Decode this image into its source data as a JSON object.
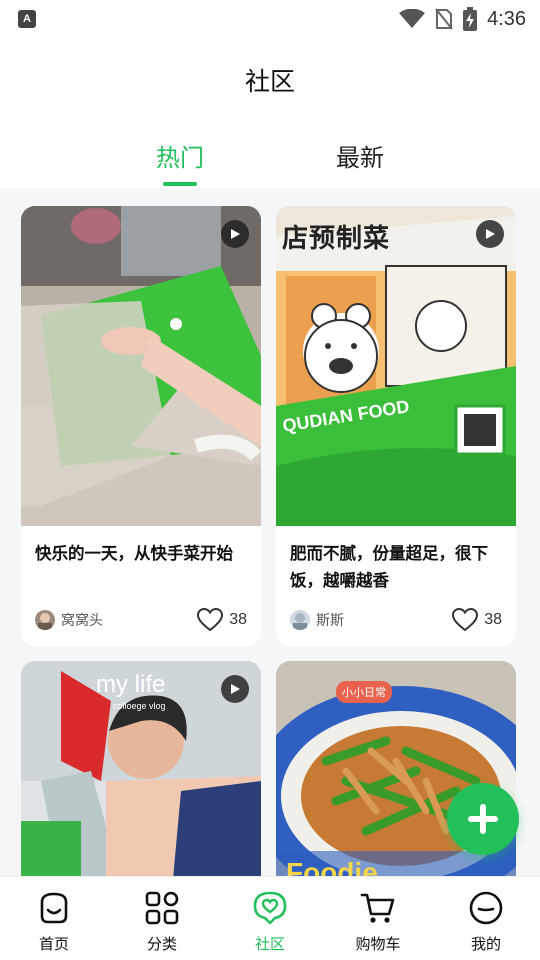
{
  "status_bar": {
    "notification_icon": "a-badge-icon",
    "badge_letter": "A",
    "time": "4:36",
    "icons": [
      "wifi-icon",
      "no-sim-icon",
      "battery-charging-icon"
    ]
  },
  "header": {
    "title": "社区",
    "tabs": [
      {
        "label": "热门",
        "active": true
      },
      {
        "label": "最新",
        "active": false
      }
    ]
  },
  "feed": {
    "cards": [
      {
        "title": "快乐的一天，从快手菜开始",
        "author": "窝窝头",
        "likes": "38",
        "is_video": true,
        "image": "hands-holding-green-food-package"
      },
      {
        "title": "肥而不腻，份量超足，很下饭，越嚼越香",
        "author": "斯斯",
        "likes": "38",
        "is_video": true,
        "image": "green-prepared-meal-package-with-cartoon-bear",
        "overlay_texts": [
          "店预制菜",
          "QUDIAN FOOD"
        ]
      },
      {
        "title": "",
        "author": "",
        "likes": "",
        "is_video": true,
        "image": "child-holding-bag-my-life-vlog",
        "overlay_texts": [
          "my life",
          "colloege vlog"
        ]
      },
      {
        "title": "",
        "author": "",
        "likes": "",
        "is_video": false,
        "image": "stir-fried-pork-with-green-peppers",
        "overlay_texts": [
          "小小日常",
          "Foodie"
        ]
      }
    ]
  },
  "fab": {
    "icon": "plus-icon"
  },
  "bottom_nav": {
    "items": [
      {
        "label": "首页",
        "icon": "home-face-icon",
        "active": false
      },
      {
        "label": "分类",
        "icon": "category-grid-icon",
        "active": false
      },
      {
        "label": "社区",
        "icon": "community-heart-icon",
        "active": true
      },
      {
        "label": "购物车",
        "icon": "cart-icon",
        "active": false
      },
      {
        "label": "我的",
        "icon": "profile-face-icon",
        "active": false
      }
    ]
  },
  "colors": {
    "accent": "#22bf5a",
    "background": "#f5f6f8",
    "card": "#ffffff",
    "text": "#111111"
  }
}
